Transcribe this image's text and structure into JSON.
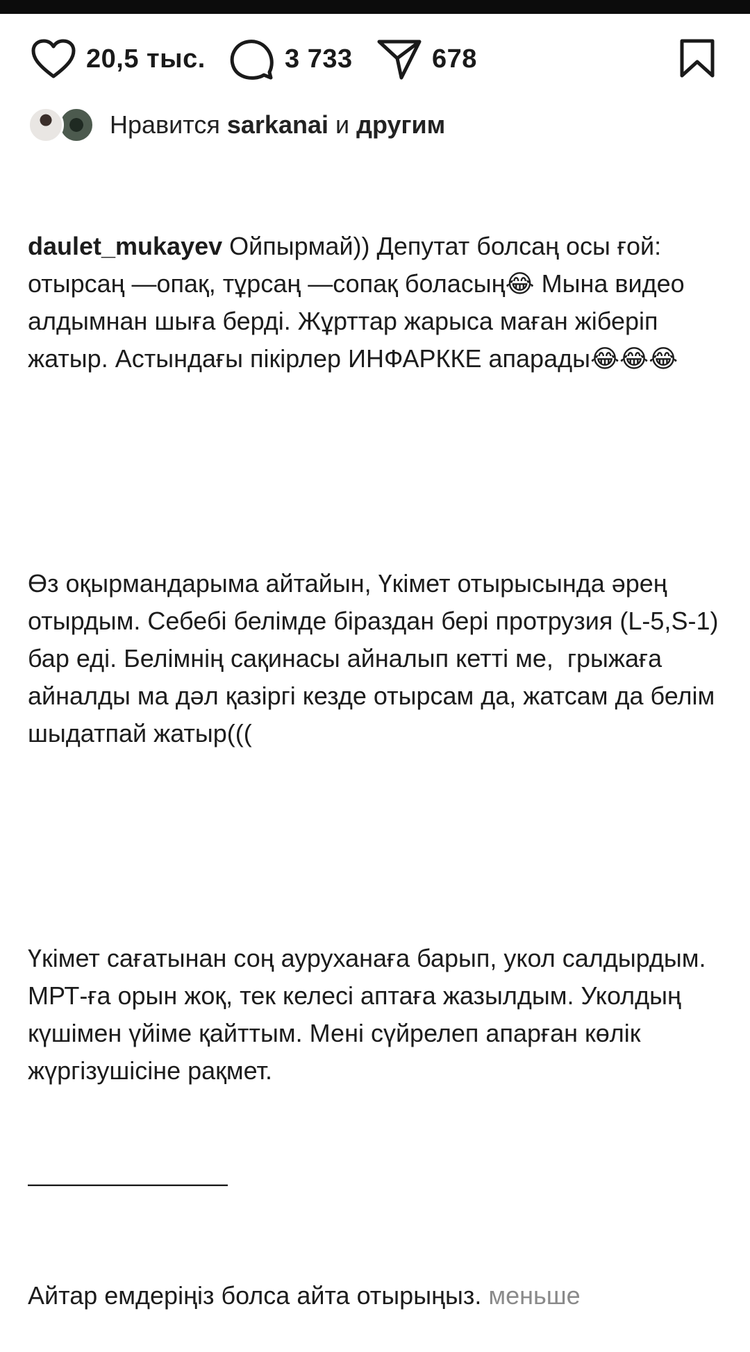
{
  "actions": {
    "likes": "20,5 тыс.",
    "comments": "3 733",
    "shares": "678"
  },
  "liked_by": {
    "prefix": "Нравится",
    "user": "sarkanai",
    "middle": "и",
    "others": "другим"
  },
  "post": {
    "username": "daulet_mukayev",
    "line1": "Ойпырмай)) Депутат болсаң осы ғой: отырсаң —опақ, тұрсаң —сопақ боласың😂",
    "line2": "Мына видео алдымнан шыға берді. Жұрттар жарыса маған жіберіп жатыр. Астындағы пікірлер ИНФАРККЕ апарады😂😂😂",
    "para2": "Өз оқырмандарыма айтайын, Үкімет отырысында әрең отырдым. Себебі белімде біраздан бері протрузия (L-5,S-1) бар еді. Белімнің сақинасы айналып кетті ме,  грыжаға айналды ма дәл қазіргі кезде отырсам да, жатсам да белім шыдатпай жатыр(((",
    "para3": "Үкімет сағатынан соң ауруханаға барып, укол салдырдым. МРТ-ға орын жоқ, тек келесі аптаға жазылдым. Уколдың күшімен үйіме қайттым. Мені сүйрелеп апарған көлік жүргізушісіне рақмет.",
    "divider": "————————",
    "closing": "Айтар емдеріңіз болса айта отырыңыз.",
    "less": "меньше"
  }
}
